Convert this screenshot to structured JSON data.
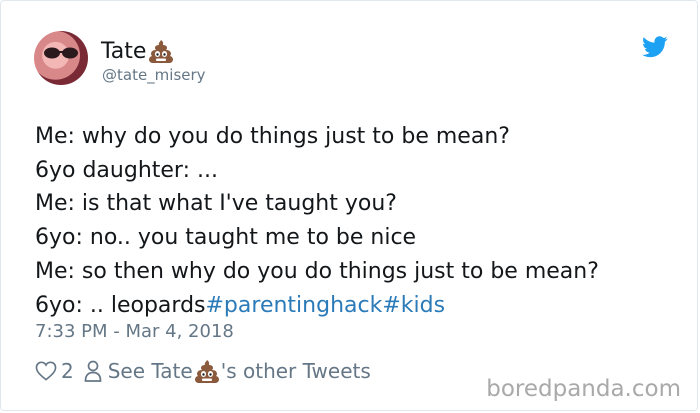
{
  "author": {
    "name": "Tate",
    "handle": "@tate_misery"
  },
  "tweet": {
    "lines": [
      "Me: why do you do things just to be mean?",
      "6yo daughter: ...",
      "Me: is that what I've taught you?",
      "6yo: no.. you taught me to be nice",
      "Me: so then why do you do things just to be mean?",
      "6yo: .. leopards"
    ],
    "hashtags": [
      "#parentinghack",
      "#kids"
    ],
    "timestamp": "7:33 PM - Mar 4, 2018"
  },
  "footer": {
    "likes": "2",
    "see_prefix": "See Tate",
    "see_suffix": "'s other Tweets"
  },
  "watermark": "boredpanda.com",
  "icons": {
    "author_emoji": "poop-icon",
    "brand": "twitter-icon",
    "like": "heart-icon",
    "profile": "person-icon"
  },
  "colors": {
    "hashtag": "#2b7bb9",
    "twitter_blue": "#1da1f2",
    "secondary_text": "#657786",
    "text": "#14171a"
  }
}
